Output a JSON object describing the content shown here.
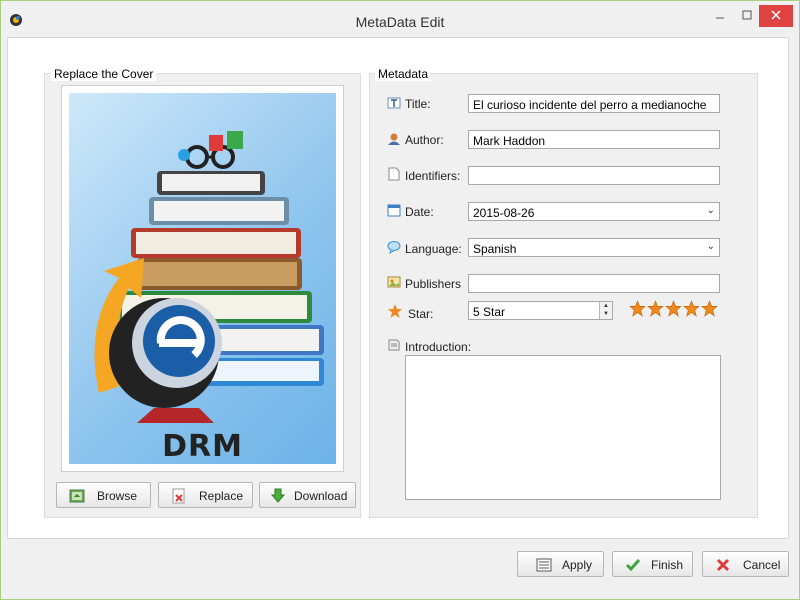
{
  "window": {
    "title": "MetaData Edit"
  },
  "cover": {
    "group_label": "Replace the Cover",
    "image_text": "DRM",
    "buttons": {
      "browse": "Browse",
      "replace": "Replace",
      "download": "Download"
    }
  },
  "metadata": {
    "group_label": "Metadata",
    "title": {
      "label": "Title:",
      "value": "El curioso incidente del perro a medianoche"
    },
    "author": {
      "label": "Author:",
      "value": "Mark Haddon"
    },
    "identifiers": {
      "label": "Identifiers:",
      "value": ""
    },
    "date": {
      "label": "Date:",
      "value": "2015-08-26"
    },
    "language": {
      "label": "Language:",
      "value": "Spanish"
    },
    "publishers": {
      "label": "Publishers",
      "value": ""
    },
    "star": {
      "label": "Star:",
      "value": "5 Star",
      "rating": 5,
      "max": 5
    },
    "introduction": {
      "label": "Introduction:",
      "value": ""
    }
  },
  "footer": {
    "apply": "Apply",
    "finish": "Finish",
    "cancel": "Cancel"
  },
  "colors": {
    "close_button": "#e04343",
    "star": "#f08a1c",
    "window_border": "#a9cf7e"
  }
}
